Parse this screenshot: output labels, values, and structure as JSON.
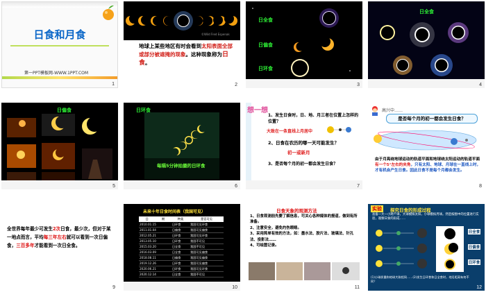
{
  "slides": [
    {
      "number": "1",
      "title": "日食和月食",
      "subtitle": "第一PPT模板网-WWW.1PPT.COM"
    },
    {
      "number": "2",
      "caption": "©Wild Fred Espenak",
      "text_a": "地球上某些地区有时会看到",
      "text_b": "太阳表面全部或部分被遮掩的现象",
      "text_c": "。这种现象称为",
      "text_d": "日食",
      "text_e": "。"
    },
    {
      "number": "3",
      "labels": [
        "日全食",
        "日偏食",
        "日环食"
      ]
    },
    {
      "number": "4",
      "label": "日全食"
    },
    {
      "number": "5",
      "label": "日偏食"
    },
    {
      "number": "6",
      "label_top": "日环食",
      "label_bottom": "每隔5分钟拍摄的日环食"
    },
    {
      "number": "7",
      "badge": "想一想",
      "q1": "1、发生日食时，日、地、月三者在位置上怎样的位置？",
      "a1": "大致在一条直线上月居中",
      "q2": "2、日食在农历的哪一天可能发生？",
      "a2": "初一或新月",
      "q3": "3、是否每个月的初一都会发生日食？"
    },
    {
      "number": "8",
      "header": "高兴中……",
      "question": "是否每个月的初一都会发生日食？",
      "body_a": "由于月亮绕地球运动的轨道平面和地球绕太阳运动的轨道平面",
      "body_b": "有一个5°左右的夹角",
      "body_c": "，只有太阳、地球、月球在一直线上时，才有机会产生日食。因此日食不是每个月都会发生。"
    },
    {
      "number": "9",
      "para_a": "全世界每年最少可发生",
      "para_b": "2次",
      "para_c": "日食，最少次，但对于某一地点而言，平均",
      "para_d": "每三年左右",
      "para_e": "就可以看到一次日偏食，",
      "para_f": "三百多年",
      "para_g": "才能看到一次日全食。"
    },
    {
      "number": "10",
      "title": "未来十年日食时间表（我国可见）",
      "headers": [
        "日",
        "期",
        "种类",
        "是否可见"
      ],
      "rows": [
        [
          "2010.01.15",
          "日环食",
          "我国可见环食"
        ],
        [
          "2011.01.04",
          "日偏食",
          "我国可见偏食"
        ],
        [
          "2012.05.21",
          "日环食",
          "我国可见环食"
        ],
        [
          "2013.05.10",
          "日环食",
          "我国不可见"
        ],
        [
          "2015.03.20",
          "日全食",
          "我国不可见"
        ],
        [
          "2016.03.09",
          "日全食",
          "我国可见偏食"
        ],
        [
          "2018.08.11",
          "日偏食",
          "我国可见偏食"
        ],
        [
          "2019.12.26",
          "日环食",
          "我国可见偏食"
        ],
        [
          "2020.06.21",
          "日环食",
          "我国可见环食"
        ],
        [
          "2020.12.14",
          "日全食",
          "我国不可见"
        ]
      ]
    },
    {
      "number": "11",
      "title": "日食天象的观测方法",
      "items": [
        "1、日食观测前先要了解信息，可关心各种媒体的报道，做到有所准备。",
        "2、注意安全，避免灼伤眼睛。",
        "3、采用简单有效的方法，如：墨水法、胶片法、玻璃法、针孔法、投影法……",
        "4、可绘图记录。"
      ]
    },
    {
      "number": "12",
      "badge": "实验",
      "title": "探究日食的形成过程",
      "body": "准备一大一小两个球，大球模拟太阳，小球模拟月球。然后按图中的位置进行实验，观察日食的形成……",
      "labels": [
        "日全食",
        "日偏食",
        "日环食"
      ],
      "footer": "(1)小球质量和地球大致相同……(2)发生日环食和日全食时，地月距离有何不同？"
    }
  ]
}
